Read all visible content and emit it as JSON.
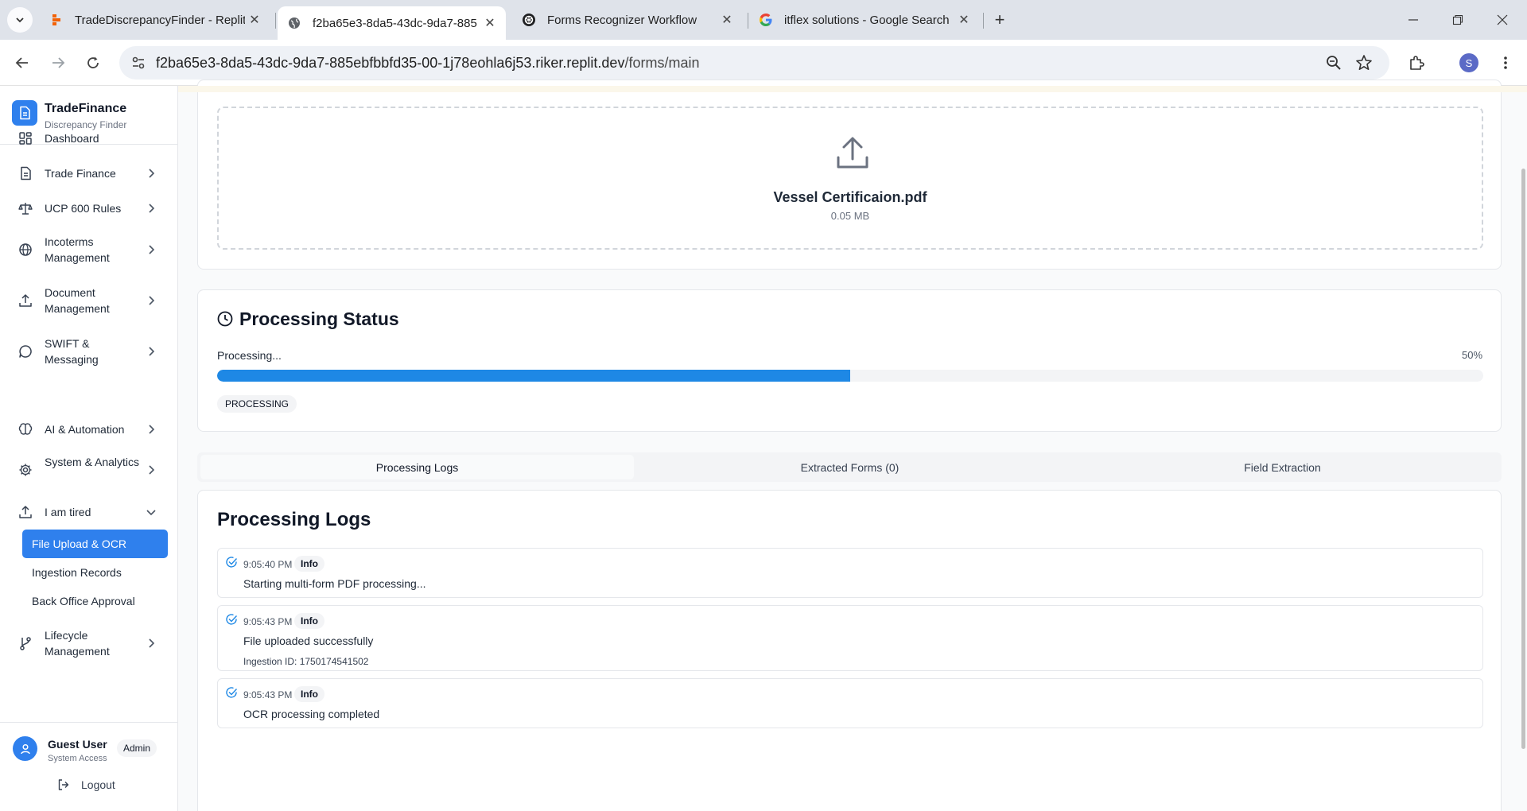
{
  "browser": {
    "tabs": [
      {
        "title": "TradeDiscrepancyFinder - Replit",
        "icon": "replit-icon"
      },
      {
        "title": "f2ba65e3-8da5-43dc-9da7-885",
        "icon": "globe-icon"
      },
      {
        "title": "Forms Recognizer Workflow",
        "icon": "openai-icon"
      },
      {
        "title": "itflex solutions - Google Search",
        "icon": "google-icon"
      }
    ],
    "url_host": "f2ba65e3-8da5-43dc-9da7-885ebfbbfd35-00-1j78eohla6j53.riker.replit.dev",
    "url_path": "/forms/main",
    "profile_initial": "S"
  },
  "sidebar": {
    "brand_title": "TradeFinance",
    "brand_subtitle": "Discrepancy Finder",
    "items": [
      {
        "label": "Dashboard",
        "icon": "dashboard-icon"
      },
      {
        "label": "Trade Finance",
        "icon": "document-icon"
      },
      {
        "label": "UCP 600 Rules",
        "icon": "scale-icon"
      },
      {
        "label": "Incoterms Management",
        "icon": "globe-icon"
      },
      {
        "label": "Document Management",
        "icon": "upload-icon"
      },
      {
        "label": "SWIFT & Messaging",
        "icon": "chat-icon"
      },
      {
        "label": "AI & Automation",
        "icon": "brain-icon"
      },
      {
        "label": "System & Analytics",
        "icon": "gear-icon"
      },
      {
        "label": "I am tired",
        "icon": "upload-icon"
      },
      {
        "label": "Lifecycle Management",
        "icon": "git-branch-icon"
      }
    ],
    "sub_items": [
      {
        "label": "File Upload & OCR"
      },
      {
        "label": "Ingestion Records"
      },
      {
        "label": "Back Office Approval"
      }
    ],
    "user": {
      "name": "Guest User",
      "role": "System Access",
      "badge": "Admin",
      "logout": "Logout"
    }
  },
  "upload": {
    "file_name": "Vessel Certificaion.pdf",
    "file_size": "0.05 MB"
  },
  "status": {
    "title": "Processing Status",
    "state_text": "Processing...",
    "percent_label": "50%",
    "progress": 0.5,
    "badge": "PROCESSING"
  },
  "tabs": [
    {
      "label": "Processing Logs"
    },
    {
      "label": "Extracted Forms (0)"
    },
    {
      "label": "Field Extraction"
    }
  ],
  "logs": {
    "title": "Processing Logs",
    "entries": [
      {
        "time": "9:05:40 PM",
        "level": "Info",
        "message": "Starting multi-form PDF processing...",
        "detail": ""
      },
      {
        "time": "9:05:43 PM",
        "level": "Info",
        "message": "File uploaded successfully",
        "detail": "Ingestion ID: 1750174541502"
      },
      {
        "time": "9:05:43 PM",
        "level": "Info",
        "message": "OCR processing completed",
        "detail": ""
      }
    ]
  },
  "colors": {
    "accent": "#2f80ed",
    "progress": "#1e88e5",
    "success_check": "#1e88e5"
  }
}
